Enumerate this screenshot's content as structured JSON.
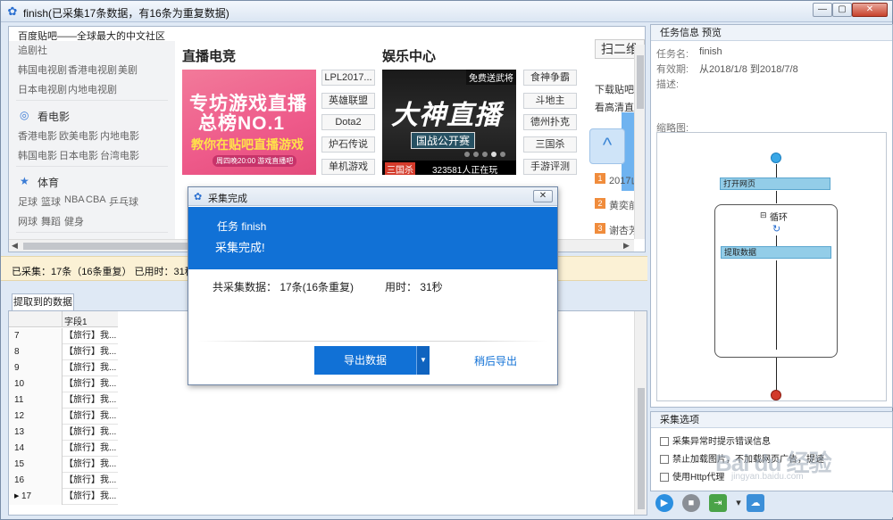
{
  "window": {
    "title": "finish(已采集17条数据，有16条为重复数据)",
    "min": "—",
    "max": "▢",
    "close": "✕"
  },
  "browser": {
    "page_title": "百度贴吧——全球最大的中文社区",
    "sidebar": {
      "top_link": "追剧社",
      "row1": [
        "韩国电视剧",
        "香港电视剧",
        "美剧"
      ],
      "row2": [
        "日本电视剧",
        "内地电视剧"
      ],
      "movie_head": "看电影",
      "movie_row1": [
        "香港电影",
        "欧美电影",
        "内地电影"
      ],
      "movie_row2": [
        "韩国电影",
        "日本电影",
        "台湾电影"
      ],
      "sports_head": "体育",
      "sports_row1": [
        "足球",
        "篮球",
        "NBA",
        "CBA",
        "乒乓球"
      ],
      "sports_row2": [
        "网球",
        "舞蹈",
        "健身"
      ]
    },
    "section1": {
      "title": "直播电竞",
      "banner_line1": "专坊游戏直播",
      "banner_line2": "总榜NO.1",
      "banner_line3": "教你在贴吧直播游戏",
      "banner_line4": "周四晚20:00  游戏直播吧",
      "tags": [
        "LPL2017...",
        "英雄联盟",
        "Dota2",
        "炉石传说",
        "单机游戏"
      ]
    },
    "section2": {
      "title": "娱乐中心",
      "banner_top": "免费送武将",
      "banner_main": "大神直播",
      "banner_sub": "国战公开赛",
      "banner_tag": "三国杀",
      "banner_viewers": "323581人正在玩",
      "tags": [
        "食神争霸",
        "斗地主",
        "德州扑克",
        "三国杀",
        "手游评测"
      ]
    },
    "qr": {
      "head": "扫二维",
      "line1": "下载贴吧/",
      "line2": "看高清直播"
    },
    "ranks": [
      {
        "n": "1",
        "t": "2017山"
      },
      {
        "n": "2",
        "t": "黄奕前"
      },
      {
        "n": "3",
        "t": "谢杏芳"
      }
    ],
    "up_arrow": "^"
  },
  "status": {
    "text": "已采集：17条（16条重复）    已用时：31秒    平"
  },
  "data_panel": {
    "tab_label": "提取到的数据",
    "column": "字段1",
    "rows": [
      {
        "n": "7",
        "v": "【旅行】我..."
      },
      {
        "n": "8",
        "v": "【旅行】我..."
      },
      {
        "n": "9",
        "v": "【旅行】我..."
      },
      {
        "n": "10",
        "v": "【旅行】我..."
      },
      {
        "n": "11",
        "v": "【旅行】我..."
      },
      {
        "n": "12",
        "v": "【旅行】我..."
      },
      {
        "n": "13",
        "v": "【旅行】我..."
      },
      {
        "n": "14",
        "v": "【旅行】我..."
      },
      {
        "n": "15",
        "v": "【旅行】我..."
      },
      {
        "n": "16",
        "v": "【旅行】我..."
      },
      {
        "n": "17",
        "v": "【旅行】我..."
      }
    ],
    "current_marker": "▶"
  },
  "task_info": {
    "header": "任务信息 预览",
    "name_label": "任务名:",
    "name_value": "finish",
    "validity_label": "有效期:",
    "validity_value": "从2018/1/8 到2018/7/8",
    "desc_label": "描述:",
    "thumb_label": "缩略图:",
    "flow": {
      "open_page": "打开网页",
      "loop": "循环",
      "loop_toggle": "⊟",
      "extract": "提取数据"
    }
  },
  "options": {
    "header": "采集选项",
    "items": [
      "采集异常时提示错误信息",
      "禁止加载图片，不加载网页广告，提速",
      "使用Http代理"
    ]
  },
  "dialog": {
    "title": "采集完成",
    "close": "✕",
    "task_line": "任务 finish",
    "done_line": "采集完成!",
    "total_line": "共采集数据：  17条(16条重复)",
    "time_line": "用时：  31秒",
    "export_label": "导出数据",
    "export_drop": "▼",
    "later_label": "稍后导出"
  },
  "watermark": {
    "brand": "Bai du 经验",
    "url": "jingyan.baidu.com"
  },
  "colors": {
    "accent": "#1171d6",
    "status_bg": "#fbf1d5",
    "chrome": "#dfe9f5"
  }
}
